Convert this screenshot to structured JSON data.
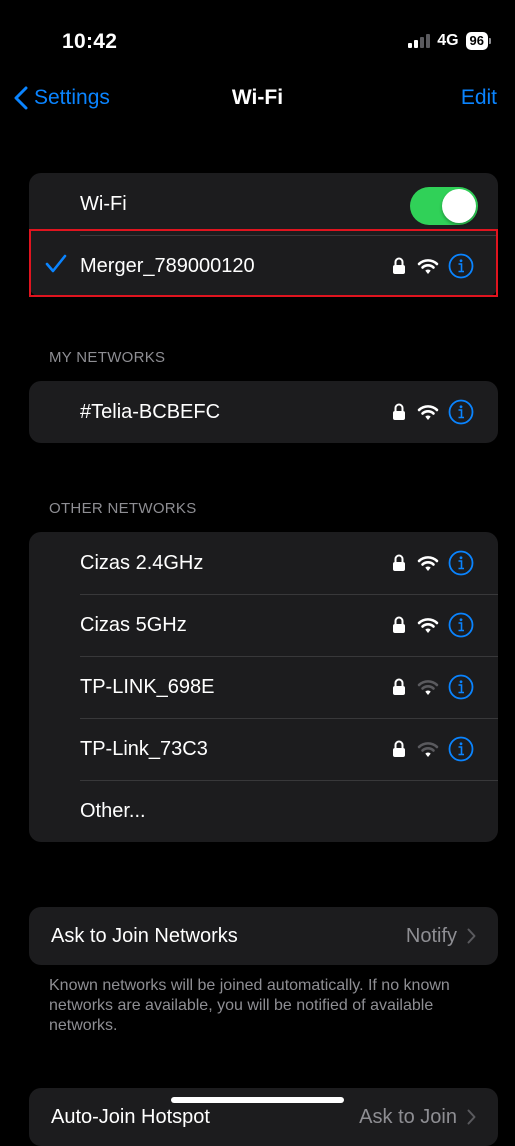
{
  "status_bar": {
    "time": "10:42",
    "network": "4G",
    "battery": "96"
  },
  "nav": {
    "back_label": "Settings",
    "title": "Wi-Fi",
    "edit_label": "Edit"
  },
  "wifi_toggle": {
    "label": "Wi-Fi",
    "on": true
  },
  "connected": {
    "name": "Merger_789000120"
  },
  "my_networks": {
    "header": "MY NETWORKS",
    "items": [
      {
        "name": "#Telia-BCBEFC"
      }
    ]
  },
  "other_networks": {
    "header": "OTHER NETWORKS",
    "items": [
      {
        "name": "Cizas 2.4GHz",
        "signal_bars": 3
      },
      {
        "name": "Cizas 5GHz",
        "signal_bars": 3
      },
      {
        "name": "TP-LINK_698E",
        "signal_bars": 1
      },
      {
        "name": "TP-Link_73C3",
        "signal_bars": 1
      }
    ],
    "other_label": "Other..."
  },
  "ask_to_join": {
    "label": "Ask to Join Networks",
    "value": "Notify",
    "footnote": "Known networks will be joined automatically. If no known networks are available, you will be notified of available networks."
  },
  "auto_join_hotspot": {
    "label": "Auto-Join Hotspot",
    "value": "Ask to Join"
  },
  "colors": {
    "accent": "#0a84ff",
    "toggle_on": "#30d158",
    "group_bg": "#1c1c1e",
    "highlight": "#e0141f"
  }
}
